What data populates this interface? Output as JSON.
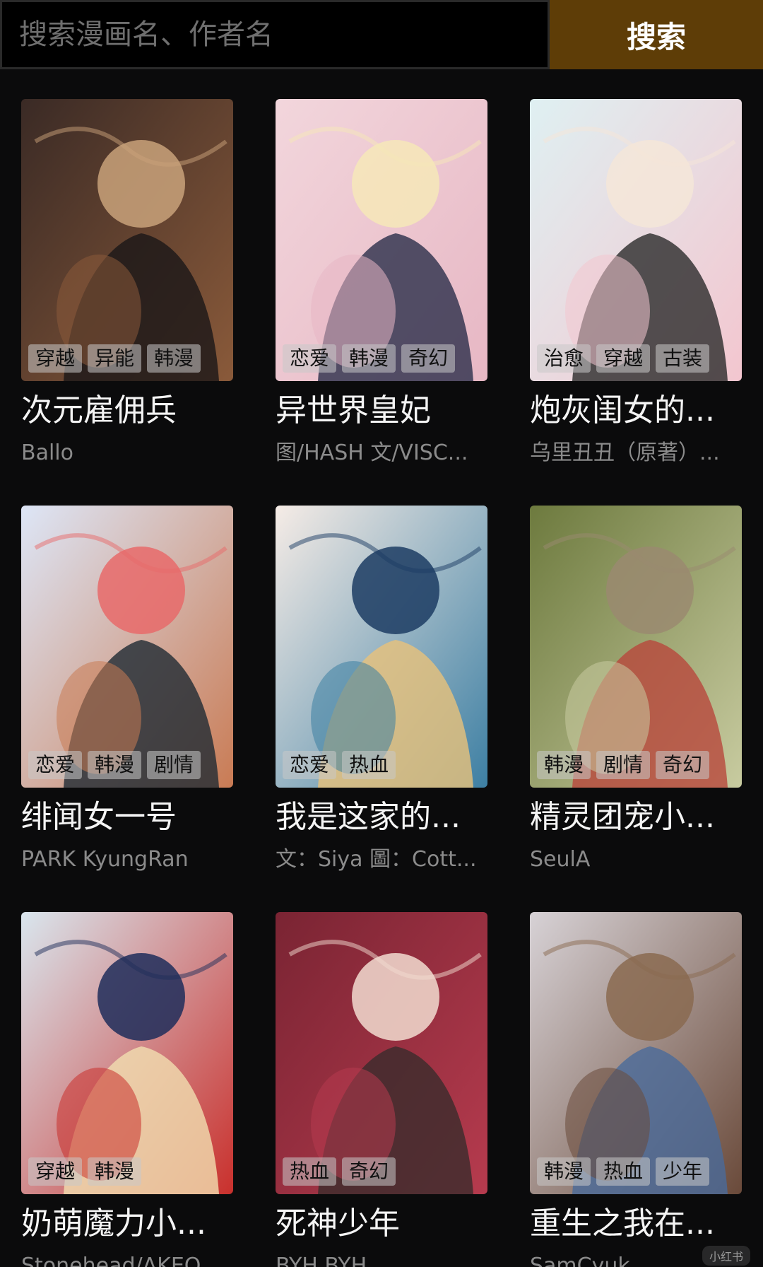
{
  "search": {
    "placeholder": "搜索漫画名、作者名",
    "button_label": "搜索"
  },
  "colors": {
    "background": "#0b0b0c",
    "search_button": "#5e3d07",
    "author_text": "#8b8b8b"
  },
  "comics": [
    {
      "title": "次元雇佣兵",
      "author": "Ballo",
      "tags": [
        "穿越",
        "异能",
        "韩漫"
      ],
      "cover_palette": [
        "#3a2a25",
        "#8a5a3a",
        "#1a1618",
        "#c9a27a"
      ]
    },
    {
      "title": "异世界皇妃",
      "author": "图/HASH 文/VISC...",
      "tags": [
        "恋爱",
        "韩漫",
        "奇幻"
      ],
      "cover_palette": [
        "#f2d6dc",
        "#e7b7c4",
        "#2b2e4a",
        "#f6e7b8"
      ]
    },
    {
      "title": "炮灰闺女的...",
      "author": "乌里丑丑（原著）...",
      "tags": [
        "治愈",
        "穿越",
        "古装"
      ],
      "cover_palette": [
        "#dff0f2",
        "#f3c6cf",
        "#2a2a2a",
        "#f5e6d8"
      ]
    },
    {
      "title": "绯闻女一号",
      "author": "PARK KyungRan",
      "tags": [
        "恋爱",
        "韩漫",
        "剧情"
      ],
      "cover_palette": [
        "#dde6f7",
        "#c97b54",
        "#1f2a33",
        "#e86a6a"
      ]
    },
    {
      "title": "我是这家的...",
      "author": "文：Siya 圖：Cott...",
      "tags": [
        "恋爱",
        "热血"
      ],
      "cover_palette": [
        "#f6ece6",
        "#3d7fa3",
        "#e8c27a",
        "#1c3c63"
      ]
    },
    {
      "title": "精灵团宠小...",
      "author": "SeulA",
      "tags": [
        "韩漫",
        "剧情",
        "奇幻"
      ],
      "cover_palette": [
        "#6d7a3e",
        "#c8cba0",
        "#b8473c",
        "#9a8a70"
      ]
    },
    {
      "title": "奶萌魔力小...",
      "author": "Stonehead/AKEO",
      "tags": [
        "穿越",
        "韩漫"
      ],
      "cover_palette": [
        "#d9e6ee",
        "#c9302c",
        "#f1deb0",
        "#1f2d5a"
      ]
    },
    {
      "title": "死神少年",
      "author": "BYH BYH",
      "tags": [
        "热血",
        "奇幻"
      ],
      "cover_palette": [
        "#7a2433",
        "#b63b4e",
        "#3a2c2c",
        "#f2dcd0"
      ]
    },
    {
      "title": "重生之我在...",
      "author": "SamCyuk",
      "tags": [
        "韩漫",
        "热血",
        "少年"
      ],
      "cover_palette": [
        "#d7d2d6",
        "#6a4a3a",
        "#4a6a9a",
        "#8a6a50"
      ]
    }
  ],
  "watermark": "小红书"
}
